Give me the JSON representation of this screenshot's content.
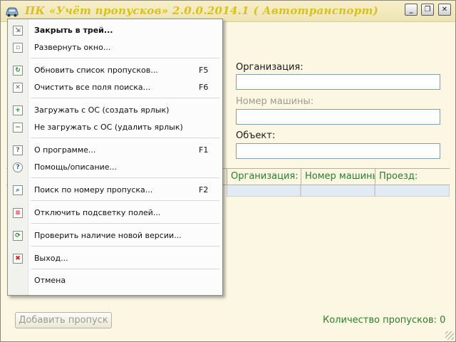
{
  "window": {
    "title": "ПК  «Учёт пропусков»  2.0.0.2014.1   ( Автотранспорт)",
    "controls": {
      "minimize": "_",
      "maximize": "❐",
      "close": "✕"
    }
  },
  "fields": {
    "organization_label": "Организация:",
    "car_number_label": "Номер машины:",
    "object_label": "Объект:",
    "organization_value": "",
    "car_number_value": "",
    "object_value": ""
  },
  "table": {
    "columns": [
      "Организация:",
      "Номер машины:",
      "Проезд:"
    ]
  },
  "bottom": {
    "add_button": "Добавить пропуск",
    "count_label": "Количество пропусков: 0"
  },
  "menu": {
    "items": [
      {
        "label": "Закрыть в трей...",
        "shortcut": "",
        "icon": "minimize-to-tray-icon",
        "glyph": "⇲",
        "bold": true
      },
      {
        "label": "Развернуть окно...",
        "shortcut": "",
        "icon": "restore-window-icon",
        "glyph": "▫",
        "bold": false
      },
      {
        "label": "Обновить список пропусков...",
        "shortcut": "F5",
        "icon": "refresh-icon",
        "glyph": "↻",
        "bold": false
      },
      {
        "label": "Очистить все поля поиска...",
        "shortcut": "F6",
        "icon": "clear-icon",
        "glyph": "✕",
        "bold": false
      },
      {
        "label": "Загружать с ОС (создать ярлык)",
        "shortcut": "",
        "icon": "add-autostart-icon",
        "glyph": "+",
        "bold": false
      },
      {
        "label": "Не загружать с ОС (удалить ярлык)",
        "shortcut": "",
        "icon": "remove-autostart-icon",
        "glyph": "−",
        "bold": false
      },
      {
        "label": "О программе...",
        "shortcut": "F1",
        "icon": "about-icon",
        "glyph": "?",
        "bold": false
      },
      {
        "label": "Помощь/описание...",
        "shortcut": "",
        "icon": "help-icon",
        "glyph": "?",
        "bold": false
      },
      {
        "label": "Поиск по номеру пропуска...",
        "shortcut": "F2",
        "icon": "search-icon",
        "glyph": "⌕",
        "bold": false
      },
      {
        "label": "Отключить подсветку полей...",
        "shortcut": "",
        "icon": "highlight-off-icon",
        "glyph": "≡",
        "bold": false
      },
      {
        "label": "Проверить наличие новой версии...",
        "shortcut": "",
        "icon": "update-check-icon",
        "glyph": "⟳",
        "bold": false
      },
      {
        "label": "Выход...",
        "shortcut": "",
        "icon": "exit-icon",
        "glyph": "✖",
        "bold": false
      },
      {
        "label": "Отмена",
        "shortcut": "",
        "icon": "",
        "glyph": "",
        "bold": false
      }
    ]
  },
  "colors": {
    "title_text": "#d8c21a",
    "window_bg": "#fbf7e2",
    "green_text": "#2a7d2a",
    "row_highlight": "#e2eaf5"
  }
}
